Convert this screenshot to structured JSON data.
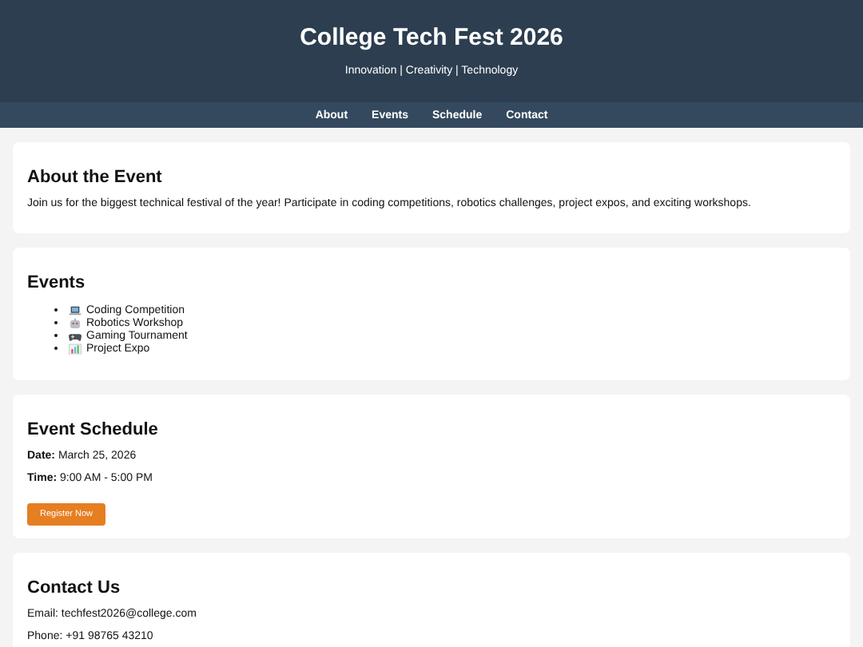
{
  "header": {
    "title": "College Tech Fest 2026",
    "tagline": "Innovation | Creativity | Technology"
  },
  "nav": [
    "About",
    "Events",
    "Schedule",
    "Contact"
  ],
  "about": {
    "heading": "About the Event",
    "text": "Join us for the biggest technical festival of the year! Participate in coding competitions, robotics challenges, project expos, and exciting workshops."
  },
  "events": {
    "heading": "Events",
    "items": [
      "Coding Competition",
      "Robotics Workshop",
      "Gaming Tournament",
      "Project Expo"
    ]
  },
  "schedule": {
    "heading": "Event Schedule",
    "lines": [
      "**Date:** March 25, 2026",
      "**Time:** 9:00 AM - 5:00 PM"
    ],
    "button": "Register Now"
  },
  "contact": {
    "heading": "Contact Us",
    "lines": [
      "Email: techfest2026@college.com",
      "Phone: +91 98765 43210"
    ]
  }
}
